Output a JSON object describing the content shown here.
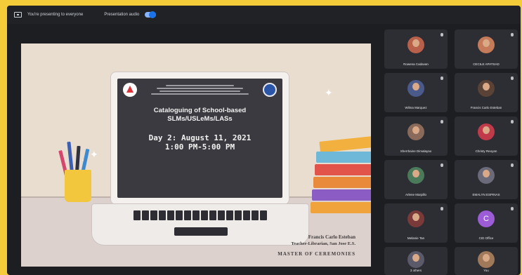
{
  "meet": {
    "presenting_text": "You're presenting to everyone",
    "presentation_audio_label": "Presentation audio"
  },
  "slide": {
    "title_line1": "Cataloguing of School-based",
    "title_line2": "SLMs/USLeMs/LASs",
    "date_line1": "Day 2: August 11, 2021",
    "date_line2": "1:00 PM-5:00 PM",
    "presenter_name": "Francis Carlo Esteban",
    "presenter_role": "Teacher-Librarian, San Jose E.S.",
    "presenter_label": "MASTER OF CEREMONIES"
  },
  "participants": [
    {
      "name": "Rowena Cadavan",
      "color": "#b8604a"
    },
    {
      "name": "CECILE APATSAD",
      "color": "#c57a5a"
    },
    {
      "name": "Wilma Marquez",
      "color": "#4a5a8a"
    },
    {
      "name": "Francis Carlo Esteban",
      "color": "#5a4236"
    },
    {
      "name": "Sherrbaine Dimalayao",
      "color": "#8a6a5a"
    },
    {
      "name": "Christy Reoyan",
      "color": "#c03a4a"
    },
    {
      "name": "Arlene Marpillo",
      "color": "#4a7a5a"
    },
    {
      "name": "EMALYN ESPINAS",
      "color": "#6a6a7a"
    },
    {
      "name": "Melanie Tan",
      "color": "#7a3a3a"
    },
    {
      "name": "CID Office",
      "initial": "C",
      "color": "#9b5cd6"
    },
    {
      "name": "3 others",
      "color": "#5a5a6a"
    },
    {
      "name": "You",
      "color": "#a0785a"
    }
  ]
}
